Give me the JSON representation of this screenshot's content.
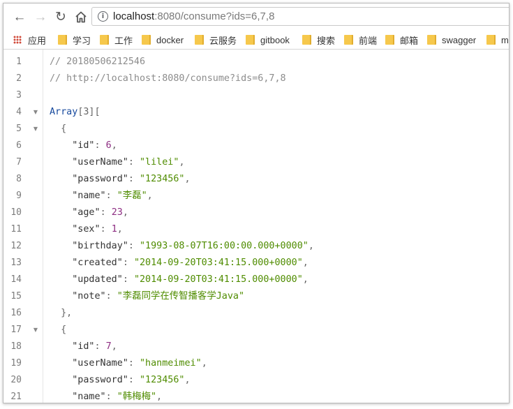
{
  "browser": {
    "url_host": "localhost",
    "url_rest": ":8080/consume?ids=6,7,8"
  },
  "bookmarks": [
    {
      "label": "应用",
      "icon": "apps-grid-icon"
    },
    {
      "label": "学习",
      "icon": "folder-icon"
    },
    {
      "label": "工作",
      "icon": "folder-icon"
    },
    {
      "label": "docker",
      "icon": "folder-icon"
    },
    {
      "label": "云服务",
      "icon": "folder-icon"
    },
    {
      "label": "gitbook",
      "icon": "folder-icon"
    },
    {
      "label": "搜索",
      "icon": "folder-icon"
    },
    {
      "label": "前端",
      "icon": "folder-icon"
    },
    {
      "label": "邮箱",
      "icon": "folder-icon"
    },
    {
      "label": "swagger",
      "icon": "folder-icon"
    },
    {
      "label": "m",
      "icon": "folder-icon"
    }
  ],
  "code": {
    "line_numbers": [
      "1",
      "2",
      "3",
      "4",
      "5",
      "6",
      "7",
      "8",
      "9",
      "10",
      "11",
      "12",
      "13",
      "14",
      "15",
      "16",
      "17",
      "18",
      "19",
      "20",
      "21"
    ],
    "comment1": "// 20180506212546",
    "comment2": "// http://localhost:8080/consume?ids=6,7,8",
    "array_label": "Array",
    "array_count": "[3]",
    "array_open": "[",
    "records": [
      {
        "id": "6",
        "userName": "\"lilei\"",
        "password": "\"123456\"",
        "name": "\"李磊\"",
        "age": "23",
        "sex": "1",
        "birthday": "\"1993-08-07T16:00:00.000+0000\"",
        "created": "\"2014-09-20T03:41:15.000+0000\"",
        "updated": "\"2014-09-20T03:41:15.000+0000\"",
        "note": "\"李磊同学在传智播客学Java\""
      },
      {
        "id": "7",
        "userName": "\"hanmeimei\"",
        "password": "\"123456\"",
        "name": "\"韩梅梅\""
      }
    ],
    "keys": {
      "id": "\"id\"",
      "userName": "\"userName\"",
      "password": "\"password\"",
      "name": "\"name\"",
      "age": "\"age\"",
      "sex": "\"sex\"",
      "birthday": "\"birthday\"",
      "created": "\"created\"",
      "updated": "\"updated\"",
      "note": "\"note\""
    }
  }
}
